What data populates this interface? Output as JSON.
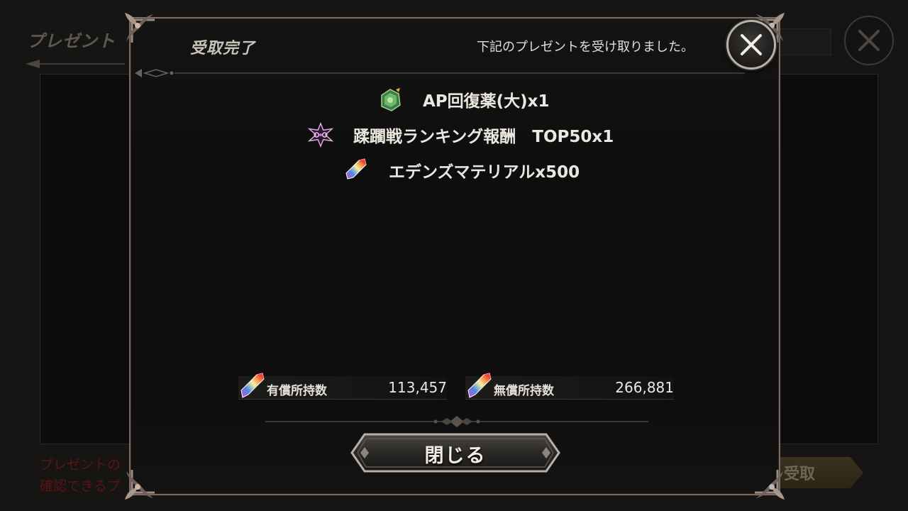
{
  "background": {
    "title": "プレゼント",
    "footer_line1": "プレゼントの",
    "footer_line2": "確認できるプ",
    "receive_button_label": "受取"
  },
  "modal": {
    "title": "受取完了",
    "message": "下記のプレゼントを受け取りました。",
    "rewards": [
      {
        "icon": "green-potion-icon",
        "label": "AP回復薬(大)x1"
      },
      {
        "icon": "purple-emblem-icon",
        "label": "蹂躙戦ランキング報酬　TOP50x1"
      },
      {
        "icon": "rainbow-crystal-icon",
        "label": "エデンズマテリアルx500"
      }
    ],
    "paid_currency": {
      "label": "有償所持数",
      "value": "113,457"
    },
    "free_currency": {
      "label": "無償所持数",
      "value": "266,881"
    },
    "close_button_label": "閉じる"
  },
  "colors": {
    "frame": "#7a6a62",
    "text": "#ece8e0",
    "footer_red": "#5a1414"
  }
}
